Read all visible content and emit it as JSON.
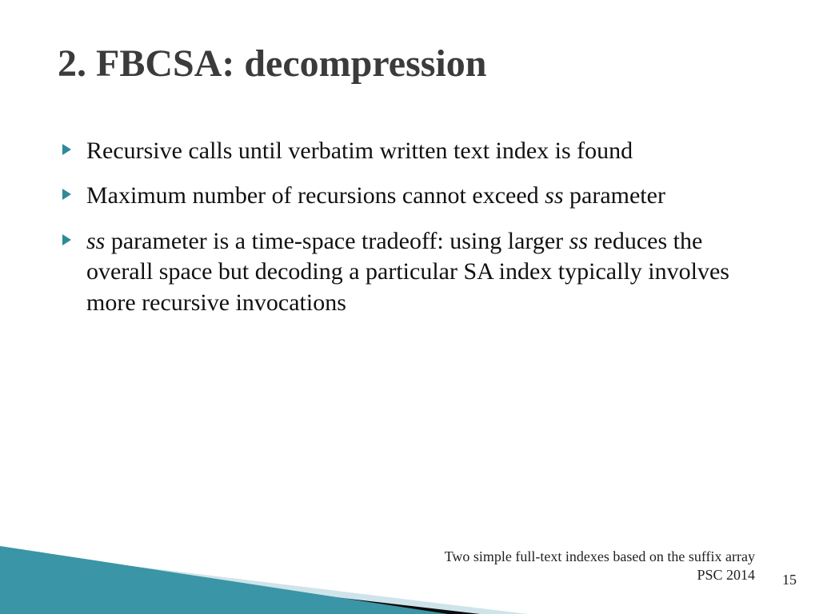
{
  "title": "2. FBCSA: decompression",
  "bullets": [
    {
      "segments": [
        {
          "text": "Recursive calls until verbatim written text index is found",
          "italic": false
        }
      ]
    },
    {
      "segments": [
        {
          "text": "Maximum number of recursions cannot exceed ",
          "italic": false
        },
        {
          "text": "ss",
          "italic": true
        },
        {
          "text": " parameter",
          "italic": false
        }
      ]
    },
    {
      "segments": [
        {
          "text": "ss",
          "italic": true
        },
        {
          "text": " parameter is a time-space tradeoff: using larger ",
          "italic": false
        },
        {
          "text": "ss",
          "italic": true
        },
        {
          "text": " reduces the overall space but decoding a particular SA index typically involves more recursive invocations",
          "italic": false
        }
      ]
    }
  ],
  "footer": {
    "line1": "Two simple full-text indexes based on the suffix array",
    "line2": "PSC 2014"
  },
  "pageNumber": "15",
  "colors": {
    "accent": "#2d8a9a",
    "decoTeal": "#3a95a6",
    "decoLight": "#cfe4ea",
    "decoDark": "#0b0b0b"
  }
}
